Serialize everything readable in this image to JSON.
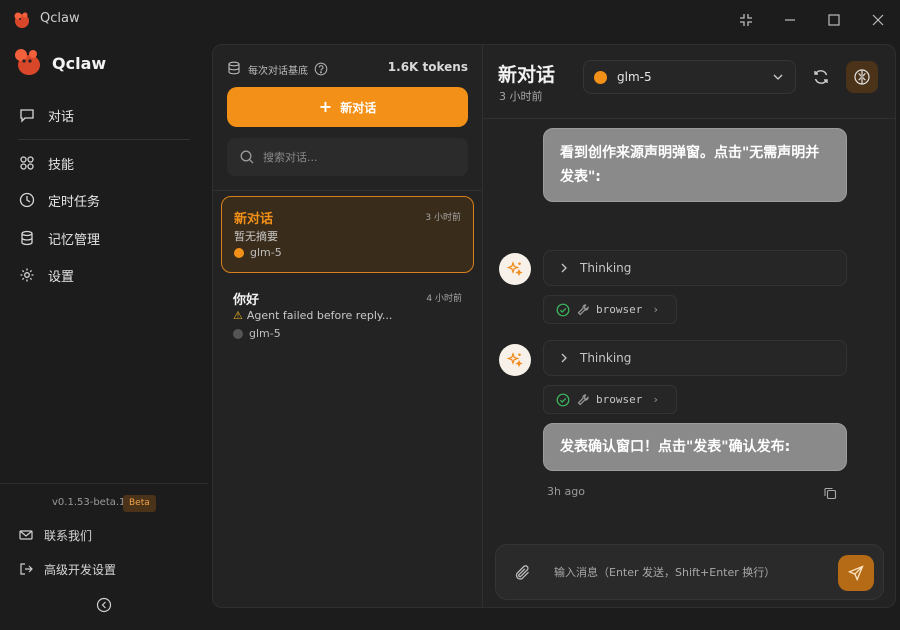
{
  "window": {
    "title": "Qclaw"
  },
  "sidebar": {
    "brand": "Qclaw",
    "items": [
      {
        "label": "对话",
        "icon": "chat-icon"
      },
      {
        "label": "技能",
        "icon": "grid-icon"
      },
      {
        "label": "定时任务",
        "icon": "clock-icon"
      },
      {
        "label": "记忆管理",
        "icon": "database-icon"
      },
      {
        "label": "设置",
        "icon": "gear-icon"
      }
    ],
    "version": "v0.1.53-beta.1",
    "badge": "Beta",
    "bottom_links": [
      {
        "label": "联系我们",
        "icon": "mail-icon"
      },
      {
        "label": "高级开发设置",
        "icon": "login-icon"
      }
    ]
  },
  "list": {
    "header_label": "每次对话基底",
    "tokens": "1.6K tokens",
    "new_chat_label": "新对话",
    "search_placeholder": "搜索对话...",
    "conversations": [
      {
        "title": "新对话",
        "time": "3 小时前",
        "summary": "暂无摘要",
        "model": "glm-5",
        "active": true,
        "dot_color": "#f39017"
      },
      {
        "title": "你好",
        "time": "4 小时前",
        "summary": "Agent failed before reply...",
        "model": "glm-5",
        "active": false,
        "dot_color": "#555555",
        "warning": "⚠"
      }
    ]
  },
  "chat": {
    "title": "新对话",
    "subtitle": "3 小时前",
    "model": "glm-5",
    "messages": {
      "top_bubble": "看到创作来源声明弹窗。点击\"无需声明并发表\":",
      "thinking_label": "Thinking",
      "tool_name": "browser",
      "bottom_bubble": "发表确认窗口！点击\"发表\"确认发布:",
      "timestamp": "3h ago"
    },
    "composer_placeholder": "输入消息（Enter 发送，Shift+Enter 换行）"
  },
  "colors": {
    "accent": "#f39017",
    "panel": "#232323",
    "bubble": "#8a8a8a"
  }
}
